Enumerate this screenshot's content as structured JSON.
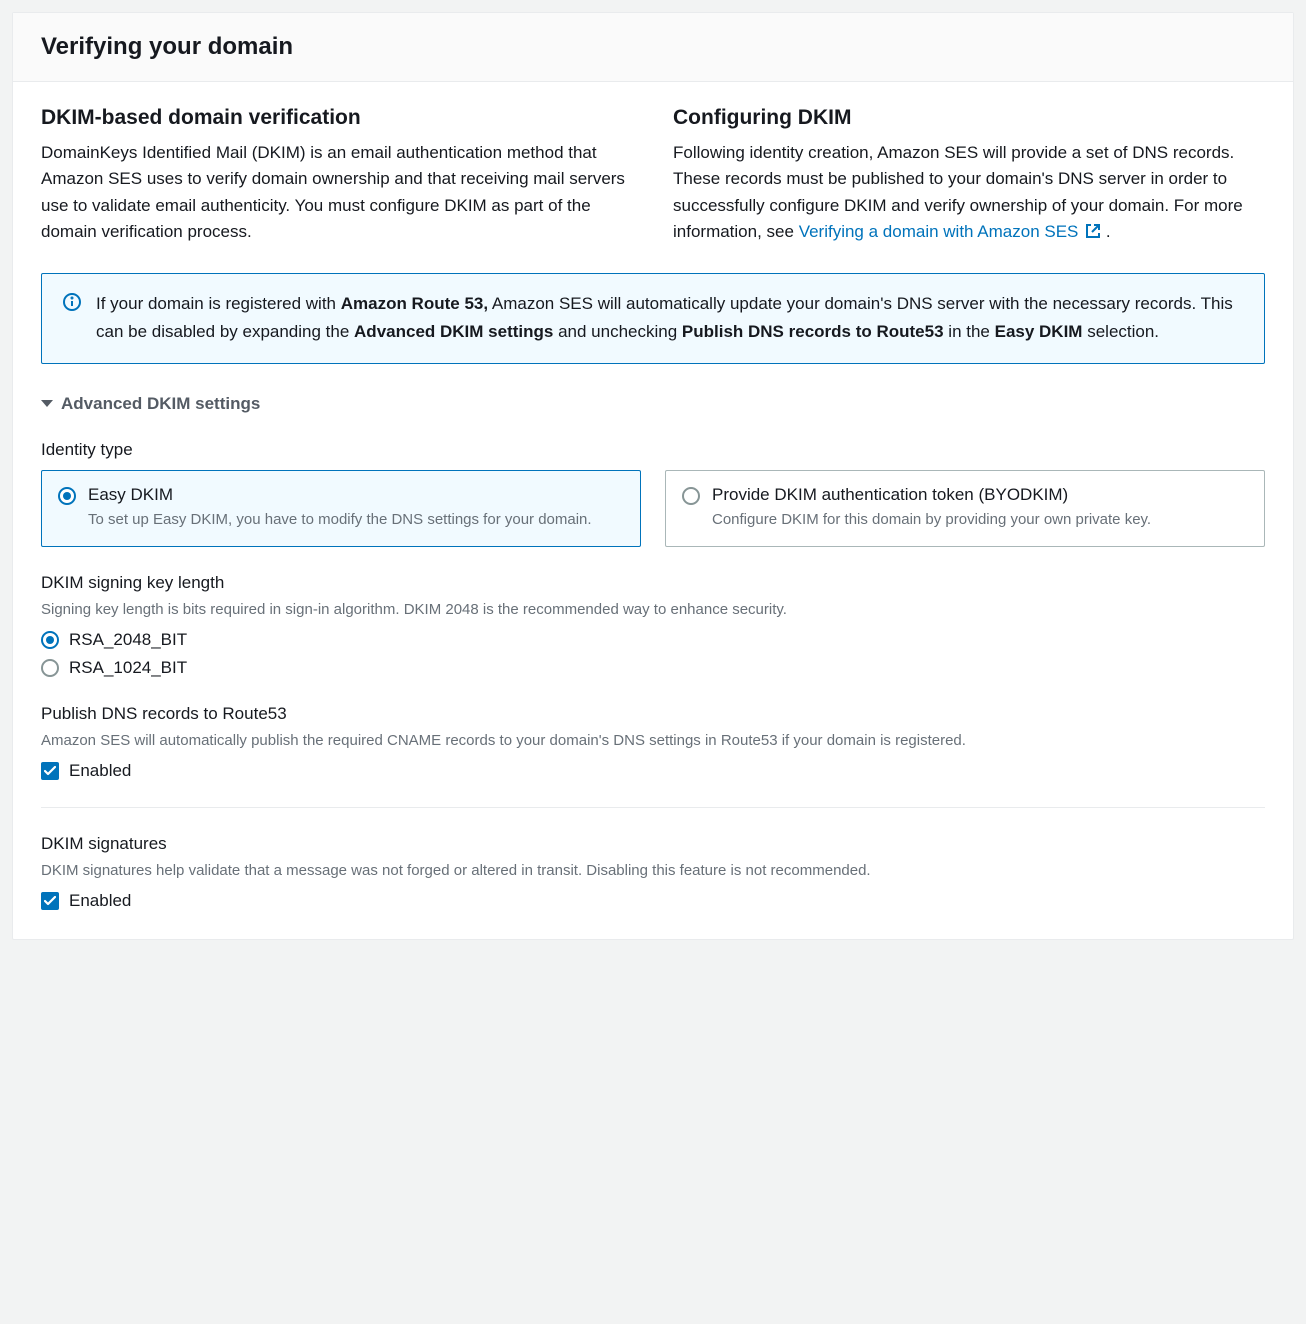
{
  "header": {
    "title": "Verifying your domain"
  },
  "left": {
    "heading": "DKIM-based domain verification",
    "body": "DomainKeys Identified Mail (DKIM) is an email authentication method that Amazon SES uses to verify domain ownership and that receiving mail servers use to validate email authenticity. You must configure DKIM as part of the domain verification process."
  },
  "right": {
    "heading": "Configuring DKIM",
    "body_prefix": "Following identity creation, Amazon SES will provide a set of DNS records. These records must be published to your domain's DNS server in order to successfully configure DKIM and verify ownership of your domain. For more information, see ",
    "link_text": "Verifying a domain with Amazon SES",
    "body_suffix": "."
  },
  "info": {
    "seg1": "If your domain is registered with ",
    "b1": "Amazon Route 53,",
    "seg2": " Amazon SES will automatically update your domain's DNS server with the necessary records. This can be disabled by expanding the ",
    "b2": "Advanced DKIM settings",
    "seg3": " and unchecking ",
    "b3": "Publish DNS records to Route53",
    "seg4": " in the ",
    "b4": "Easy DKIM",
    "seg5": " selection."
  },
  "advanced": {
    "title": "Advanced DKIM settings",
    "identity_type_label": "Identity type",
    "options": [
      {
        "title": "Easy DKIM",
        "desc": "To set up Easy DKIM, you have to modify the DNS settings for your domain.",
        "selected": true
      },
      {
        "title": "Provide DKIM authentication token (BYODKIM)",
        "desc": "Configure DKIM for this domain by providing your own private key.",
        "selected": false
      }
    ],
    "keylen": {
      "label": "DKIM signing key length",
      "help": "Signing key length is bits required in sign-in algorithm. DKIM 2048 is the recommended way to enhance security.",
      "opts": [
        {
          "label": "RSA_2048_BIT",
          "selected": true
        },
        {
          "label": "RSA_1024_BIT",
          "selected": false
        }
      ]
    },
    "publish": {
      "label": "Publish DNS records to Route53",
      "help": "Amazon SES will automatically publish the required CNAME records to your domain's DNS settings in Route53 if your domain is registered.",
      "checkbox_label": "Enabled"
    },
    "sigs": {
      "label": "DKIM signatures",
      "help": "DKIM signatures help validate that a message was not forged or altered in transit. Disabling this feature is not recommended.",
      "checkbox_label": "Enabled"
    }
  }
}
